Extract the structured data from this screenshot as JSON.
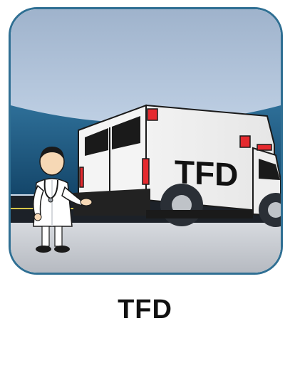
{
  "app": {
    "label": "TFD",
    "vehicle_text": "TFD",
    "icon": "ambulance-doctor-icon"
  },
  "colors": {
    "sky_top": "#a9bdd6",
    "sky_mid": "#c9d9ec",
    "band_blue": "#2e6f98",
    "road": "#1f2329",
    "ground": "#c9cdd3",
    "tile_border": "#2f6f93",
    "light_red": "#e52a2f",
    "label": "#111111"
  }
}
